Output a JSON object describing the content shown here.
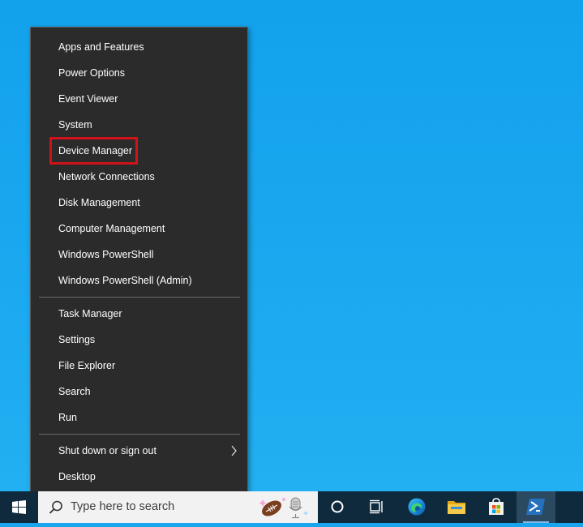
{
  "menu": {
    "group1": [
      {
        "label": "Apps and Features"
      },
      {
        "label": "Power Options"
      },
      {
        "label": "Event Viewer"
      },
      {
        "label": "System"
      },
      {
        "label": "Device Manager",
        "highlighted": true
      },
      {
        "label": "Network Connections"
      },
      {
        "label": "Disk Management"
      },
      {
        "label": "Computer Management"
      },
      {
        "label": "Windows PowerShell"
      },
      {
        "label": "Windows PowerShell (Admin)"
      }
    ],
    "group2": [
      {
        "label": "Task Manager"
      },
      {
        "label": "Settings"
      },
      {
        "label": "File Explorer"
      },
      {
        "label": "Search"
      },
      {
        "label": "Run"
      }
    ],
    "group3": [
      {
        "label": "Shut down or sign out",
        "submenu": true
      },
      {
        "label": "Desktop"
      }
    ]
  },
  "taskbar": {
    "search_placeholder": "Type here to search",
    "pinned": [
      "cortana-icon",
      "task-view-icon",
      "edge-icon",
      "file-explorer-icon",
      "store-icon",
      "powershell-icon"
    ],
    "colors": {
      "highlight": "#d0121b",
      "taskbar": "#0e2a3c",
      "desktop": "#1aa6ee"
    }
  }
}
